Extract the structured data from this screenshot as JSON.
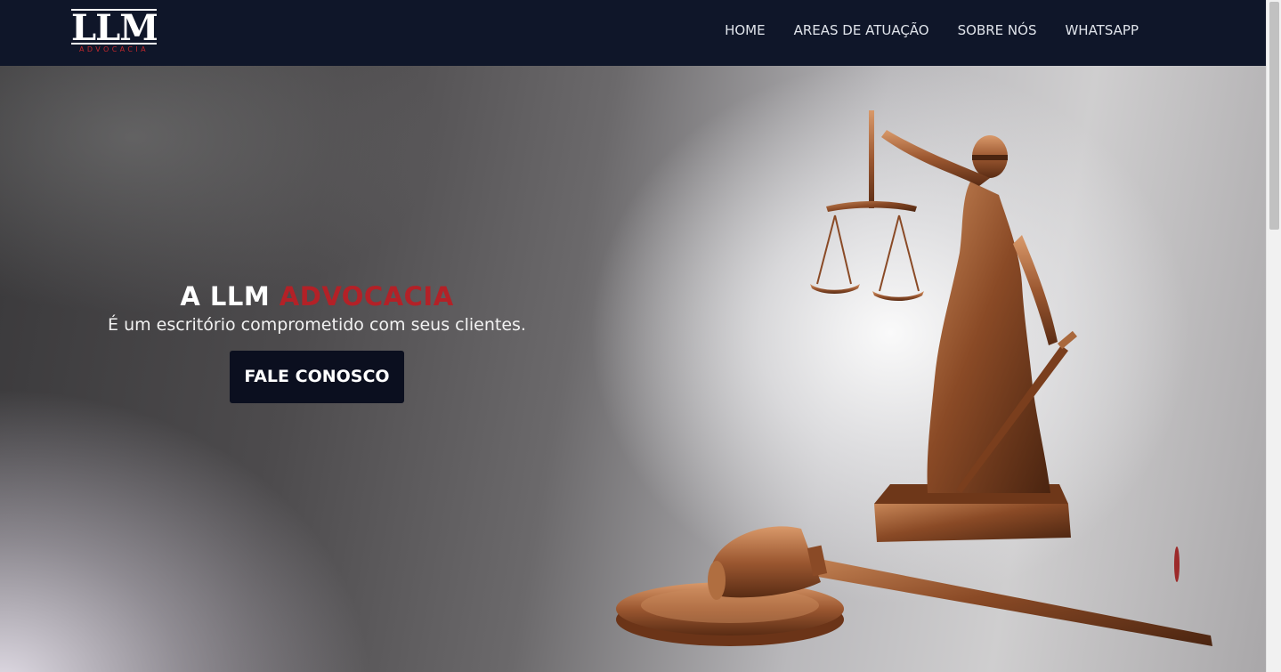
{
  "brand": {
    "logo_main": "LLM",
    "logo_sub": "ADVOCACIA"
  },
  "nav": {
    "items": [
      {
        "label": "HOME"
      },
      {
        "label": "AREAS DE ATUAÇÃO"
      },
      {
        "label": "SOBRE NÓS"
      },
      {
        "label": "WHATSAPP"
      }
    ]
  },
  "hero": {
    "title_prefix": "A LLM",
    "title_accent": "ADVOCACIA",
    "subtitle": "É um escritório comprometido com seus clientes.",
    "cta_label": "FALE CONOSCO"
  },
  "colors": {
    "navbar_bg": "#0f1629",
    "accent_red": "#b32127",
    "cta_bg": "#0b0f1f"
  },
  "icons": [
    "justice-statue-image",
    "gavel-image"
  ]
}
